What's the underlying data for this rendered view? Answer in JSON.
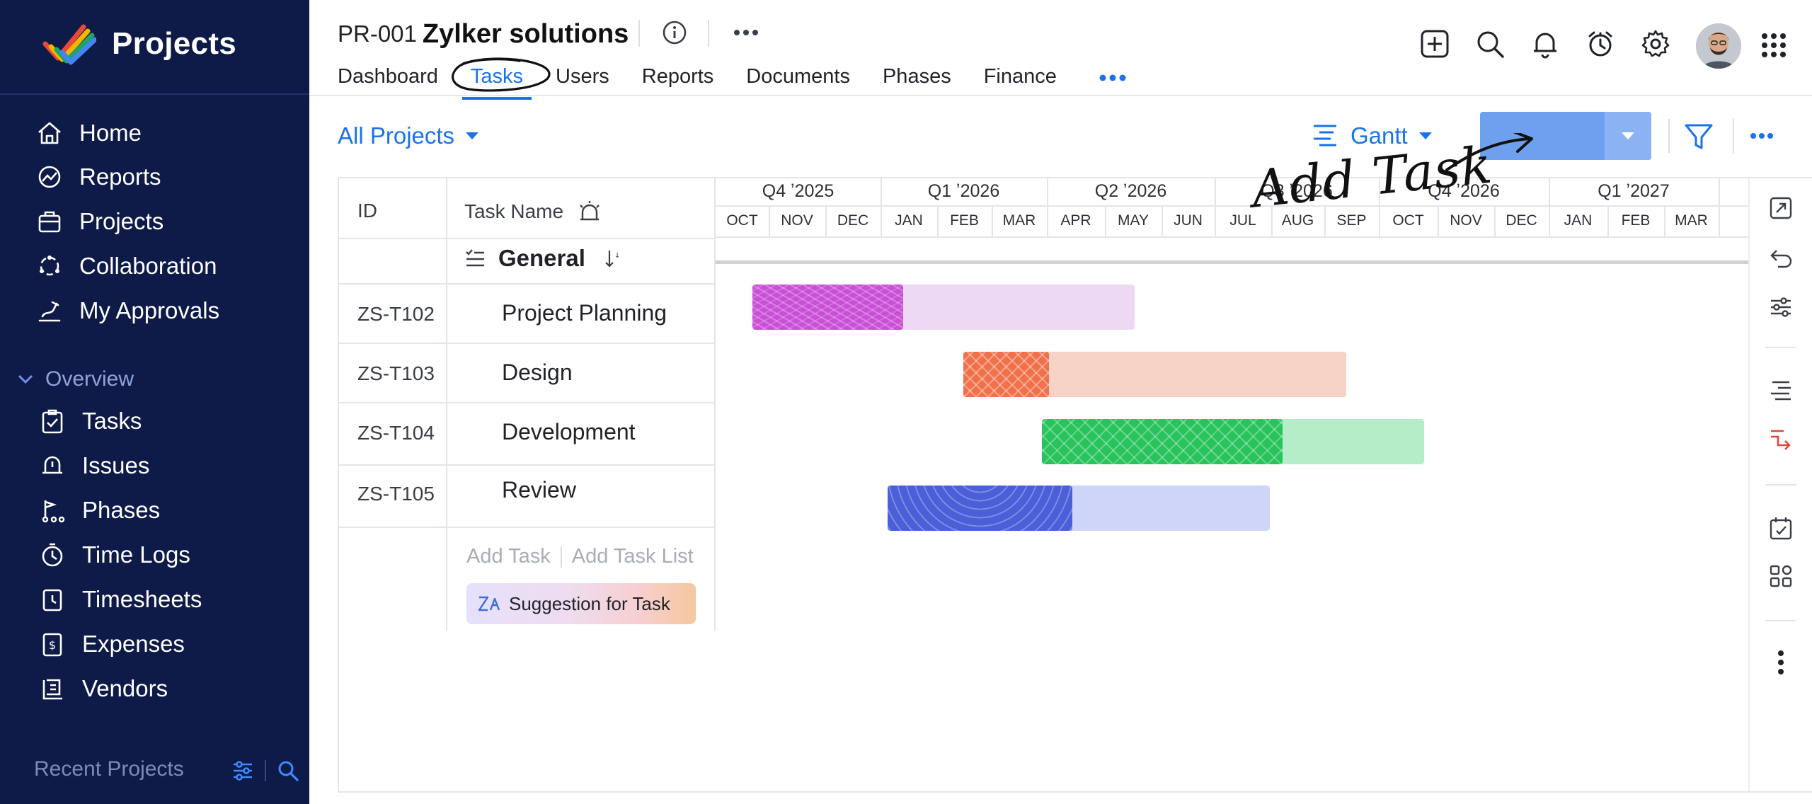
{
  "sidebar": {
    "brand": "Projects",
    "nav": [
      {
        "label": "Home",
        "icon": "home-icon"
      },
      {
        "label": "Reports",
        "icon": "reports-icon"
      },
      {
        "label": "Projects",
        "icon": "projects-icon"
      },
      {
        "label": "Collaboration",
        "icon": "collaboration-icon"
      },
      {
        "label": "My Approvals",
        "icon": "approvals-icon"
      }
    ],
    "overview_label": "Overview",
    "overview_items": [
      {
        "label": "Tasks",
        "icon": "tasks-icon"
      },
      {
        "label": "Issues",
        "icon": "issues-icon"
      },
      {
        "label": "Phases",
        "icon": "phases-icon"
      },
      {
        "label": "Time Logs",
        "icon": "timelogs-icon"
      },
      {
        "label": "Timesheets",
        "icon": "timesheets-icon"
      },
      {
        "label": "Expenses",
        "icon": "expenses-icon"
      },
      {
        "label": "Vendors",
        "icon": "vendors-icon"
      }
    ],
    "recent_label": "Recent Projects"
  },
  "header": {
    "project_id": "PR-001",
    "project_name": "Zylker solutions",
    "tabs": [
      "Dashboard",
      "Tasks",
      "Users",
      "Reports",
      "Documents",
      "Phases",
      "Finance"
    ],
    "active_tab": "Tasks"
  },
  "toolbar": {
    "project_filter": "All Projects",
    "view_mode": "Gantt",
    "annotation_text": "Add Task"
  },
  "table": {
    "col_id": "ID",
    "col_task": "Task Name",
    "group_name": "General",
    "rows": [
      {
        "id": "ZS-T102",
        "name": "Project Planning"
      },
      {
        "id": "ZS-T103",
        "name": "Design"
      },
      {
        "id": "ZS-T104",
        "name": "Development"
      },
      {
        "id": "ZS-T105",
        "name": "Review"
      }
    ],
    "add_task": "Add Task",
    "add_task_list": "Add Task List",
    "suggestion": "Suggestion for Task"
  },
  "timeline": {
    "quarters": [
      "Q4 ʼ2025",
      "Q1 ʼ2026",
      "Q2 ʼ2026",
      "Q3 ʼ2026",
      "Q4 ʼ2026",
      "Q1 ʼ2027"
    ],
    "months": [
      "OCT",
      "NOV",
      "DEC",
      "JAN",
      "FEB",
      "MAR",
      "APR",
      "MAY",
      "JUN",
      "JUL",
      "AUG",
      "SEP",
      "OCT",
      "NOV",
      "DEC",
      "JAN",
      "FEB",
      "MAR"
    ]
  },
  "colors": {
    "sidebar_bg": "#0e1a47",
    "accent": "#1a73e8",
    "planning": "#c94fd6",
    "design": "#f0704a",
    "development": "#28c35c",
    "review": "#4a5fd8"
  }
}
